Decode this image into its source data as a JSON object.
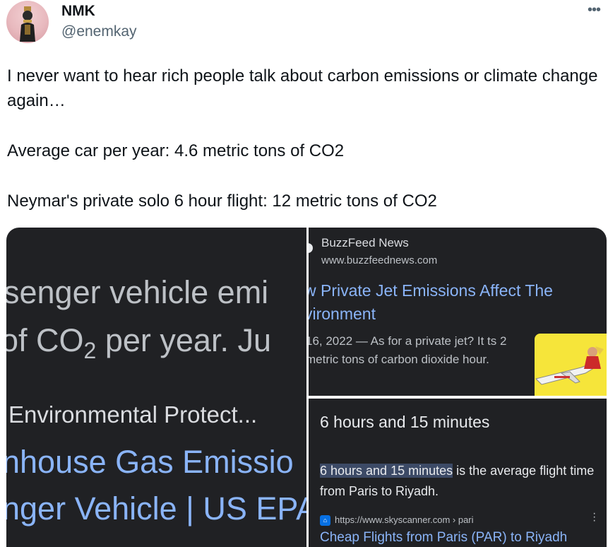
{
  "tweet": {
    "author_name": "NMK",
    "author_handle": "@enemkay",
    "more_icon": "more-horizontal-icon",
    "text": {
      "p1": "I never want to hear rich people talk about carbon emissions or climate change again…",
      "p2": "Average car per year: 4.6 metric tons of CO2",
      "p3": "Neymar's private solo 6 hour flight: 12 metric tons of CO2"
    }
  },
  "media": {
    "left_panel": {
      "line1": "senger vehicle emi",
      "line2_pre": "of CO",
      "line2_sub": "2",
      "line2_post": " per year.  Ju",
      "line3": "Environmental Protect...",
      "line4": "nhouse Gas Emissio",
      "line5": "nger Vehicle | US EPA"
    },
    "top_right": {
      "source": "BuzzFeed News",
      "url": "www.buzzfeednews.com",
      "title": "w Private Jet Emissions Affect The vironment",
      "snippet": "16, 2022 — As for a private jet? It ts 2 metric tons of carbon dioxide hour."
    },
    "bottom_right": {
      "heading": "6 hours and 15 minutes",
      "answer_highlight": "6 hours and 15 minutes",
      "answer_rest": " is the average flight time from Paris to Riyadh.",
      "cite_url": "https://www.skyscanner.com",
      "cite_path": " › pari",
      "result_title": "Cheap Flights from Paris (PAR) to Riyadh"
    }
  },
  "colors": {
    "accent_link": "#8ab4f8",
    "dark_bg": "#202124",
    "handle_gray": "#536471"
  }
}
